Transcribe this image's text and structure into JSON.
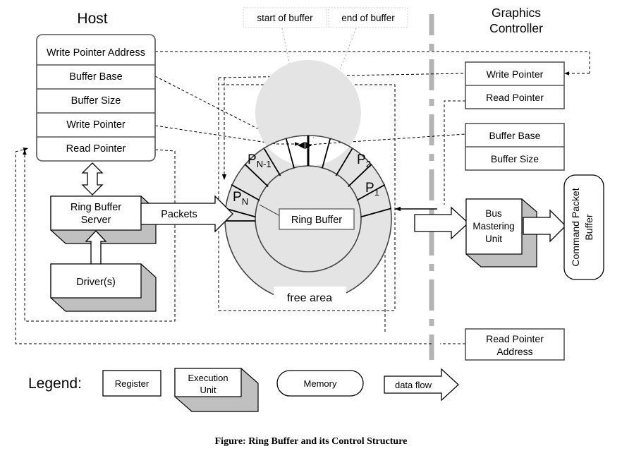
{
  "figure": {
    "caption": "Figure: Ring Buffer and its Control Structure"
  },
  "host": {
    "title": "Host",
    "registers": [
      "Write Pointer Address",
      "Buffer Base",
      "Buffer Size",
      "Write Pointer",
      "Read Pointer"
    ],
    "units": [
      "Ring Buffer Server",
      "Driver(s)"
    ],
    "unit_lines": {
      "ring_buffer_server": [
        "Ring Buffer",
        "Server"
      ],
      "drivers": [
        "Driver(s)"
      ]
    },
    "data_flow_label": "Packets"
  },
  "graphics_controller": {
    "title_lines": [
      "Graphics",
      "Controller"
    ],
    "pointer_registers": [
      "Write Pointer",
      "Read Pointer"
    ],
    "buffer_registers": [
      "Buffer Base",
      "Buffer Size"
    ],
    "read_pointer_address": {
      "lines": [
        "Read Pointer",
        "Address"
      ]
    },
    "units": [
      "Bus Mastering Unit"
    ],
    "unit_lines": {
      "bus_mastering_unit": [
        "Bus",
        "Mastering",
        "Unit"
      ]
    },
    "memory": {
      "lines": [
        "Command Packet",
        "Buffer"
      ]
    }
  },
  "ring": {
    "center_label": "Ring Buffer",
    "free_area_label": "free area",
    "packet_labels": [
      {
        "base": "P",
        "sub": "N"
      },
      {
        "base": "P",
        "sub": "N-1"
      },
      {
        "base": "P",
        "sub": "2"
      },
      {
        "base": "P",
        "sub": "1"
      }
    ],
    "markers": {
      "start_of_buffer": "start of buffer",
      "end_of_buffer": "end of buffer"
    }
  },
  "legend": {
    "title": "Legend:",
    "items": [
      {
        "label": "Register",
        "shape": "rectangle"
      },
      {
        "label_lines": [
          "Execution",
          "Unit"
        ],
        "label": "Execution Unit",
        "shape": "cube"
      },
      {
        "label": "Memory",
        "shape": "rounded"
      },
      {
        "label": "data flow",
        "shape": "block-arrow"
      }
    ]
  },
  "colors": {
    "ring_fill": "#e4e4e4",
    "cube_side": "#c0c0c0",
    "line": "#000000",
    "divider": "#b4b4b4",
    "register_border": "#555555"
  }
}
